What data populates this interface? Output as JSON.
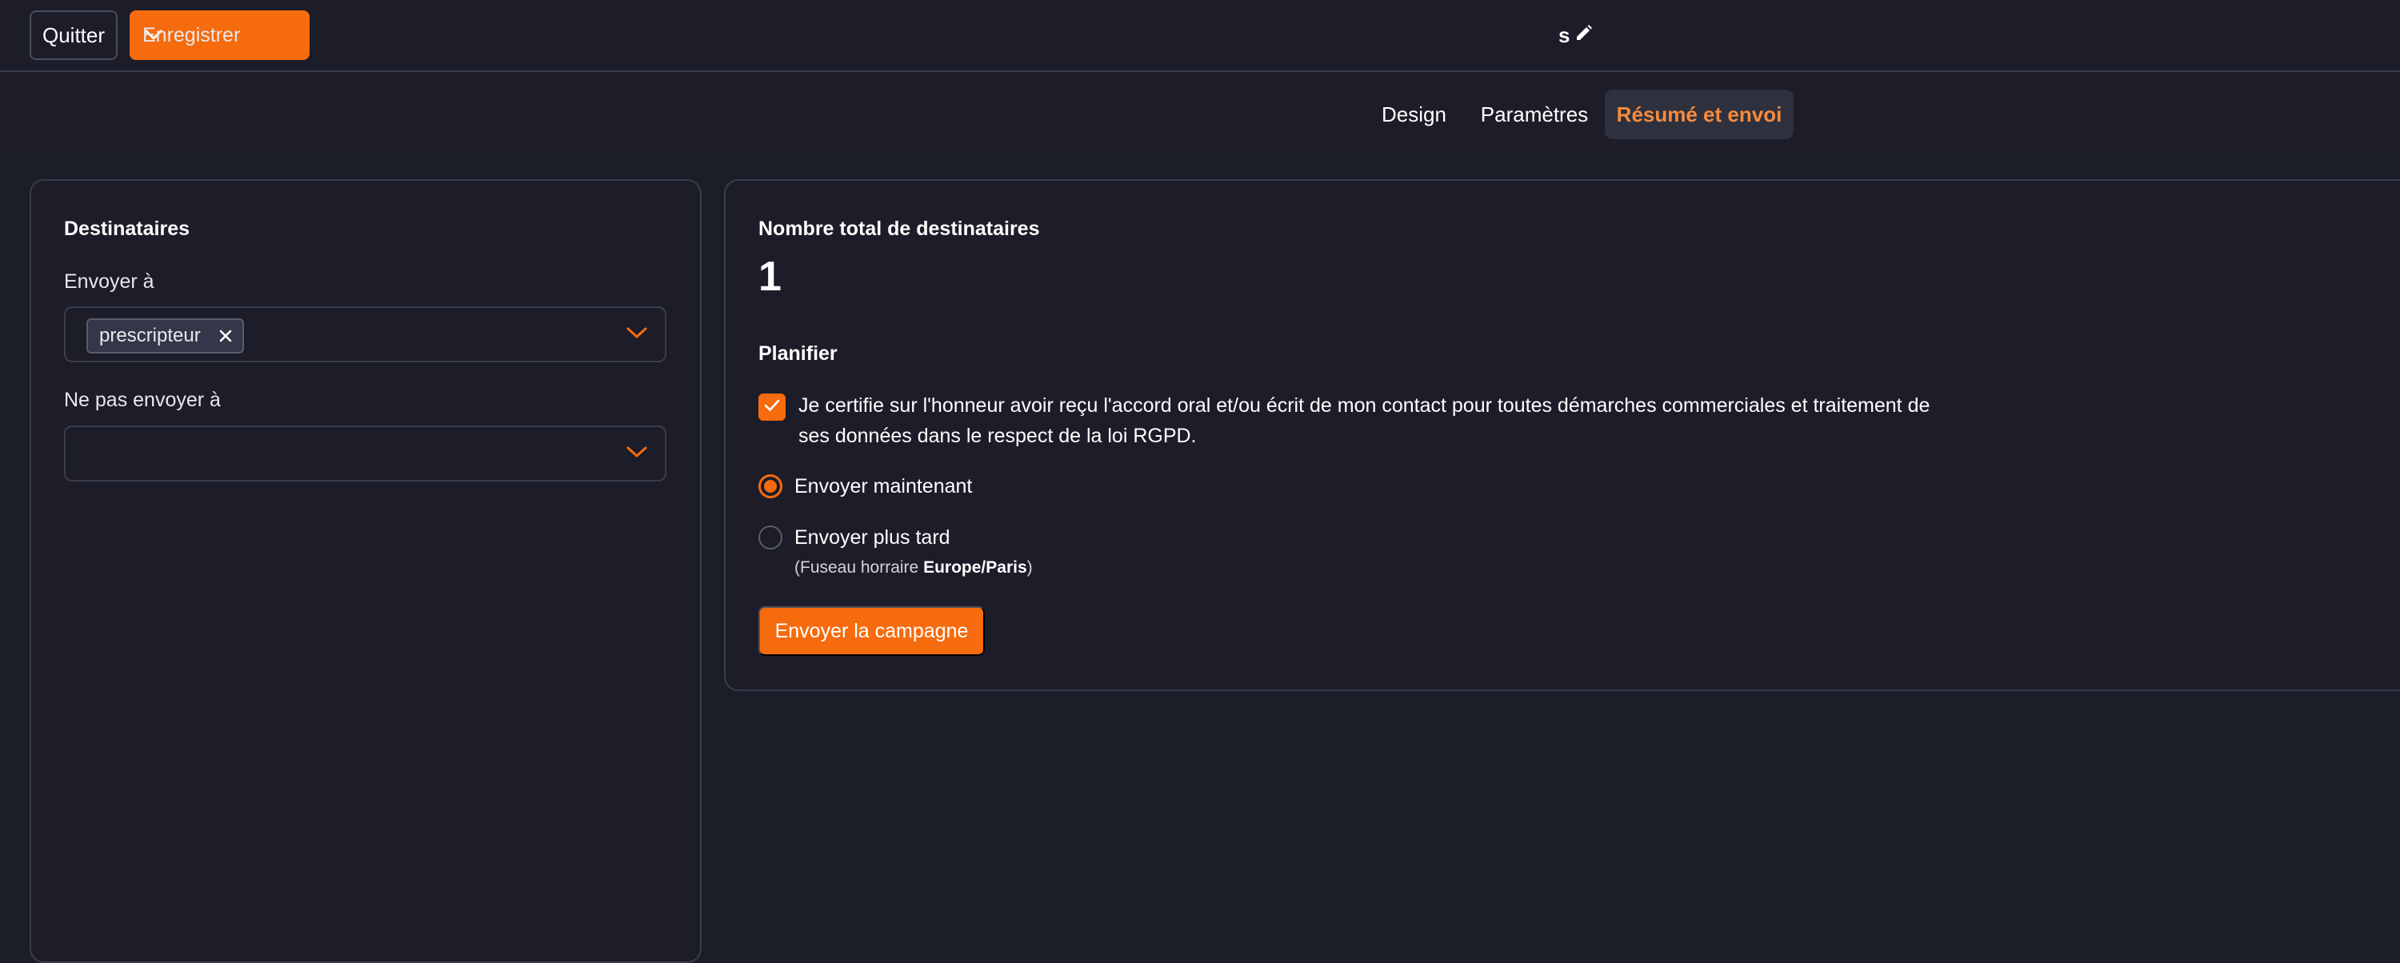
{
  "header": {
    "quit_label": "Quitter",
    "save_label": "Enregistrer",
    "campaign_title": "s"
  },
  "tabs": [
    {
      "label": "Design",
      "active": false
    },
    {
      "label": "Paramètres",
      "active": false
    },
    {
      "label": "Résumé et envoi",
      "active": true
    }
  ],
  "recipients": {
    "title": "Destinataires",
    "send_to_label": "Envoyer à",
    "send_to_values": [
      "prescripteur"
    ],
    "exclude_label": "Ne pas envoyer à",
    "exclude_values": []
  },
  "summary": {
    "total_label": "Nombre total de destinataires",
    "total_value": "1",
    "schedule_title": "Planifier",
    "consent_text": "Je certifie sur l'honneur avoir reçu l'accord oral et/ou écrit de mon contact pour toutes démarches commerciales et traitement de ses données dans le respect de la loi RGPD.",
    "consent_checked": true,
    "send_now_label": "Envoyer maintenant",
    "send_now_selected": true,
    "send_later_label": "Envoyer plus tard",
    "timezone_prefix": "(Fuseau horraire ",
    "timezone_value": "Europe/Paris",
    "timezone_suffix": ")",
    "send_button_label": "Envoyer la campagne"
  },
  "colors": {
    "accent": "#f66b0e",
    "background": "#1b1d29",
    "panel": "#1d1c29",
    "border": "#3a3d4a",
    "active_tab_text": "#f98a3d"
  },
  "icons": {
    "title_edit": "pencil-icon",
    "save_dropdown": "chevron-down-icon",
    "chip_remove": "close-icon",
    "select_caret": "chevron-down-icon",
    "checkbox_mark": "check-icon"
  }
}
